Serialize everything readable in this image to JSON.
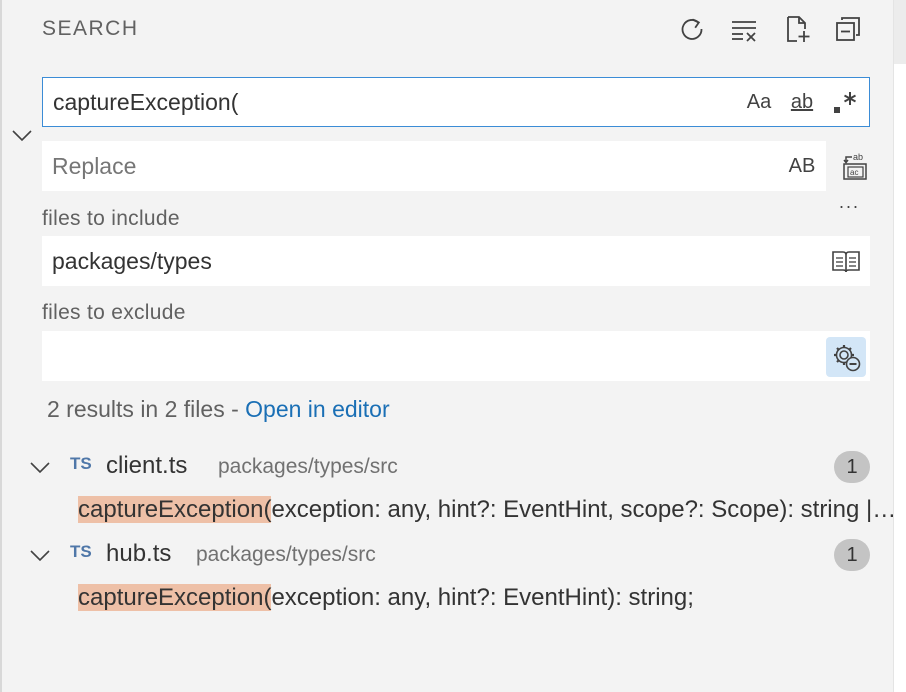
{
  "header": {
    "title": "SEARCH"
  },
  "search": {
    "value": "captureException(",
    "options": {
      "match_case": "Aa",
      "whole_word": "ab",
      "regex": ".*"
    }
  },
  "replace": {
    "placeholder": "Replace",
    "options": {
      "preserve_case": "AB"
    }
  },
  "more_label": "···",
  "include": {
    "label": "files to include",
    "value": "packages/types"
  },
  "exclude": {
    "label": "files to exclude",
    "value": ""
  },
  "summary": {
    "text": "2 results in 2 files - ",
    "link": "Open in editor"
  },
  "results": [
    {
      "lang": "TS",
      "file": "client.ts",
      "path": "packages/types/src",
      "count": "1",
      "match": "captureException(",
      "rest": "exception: any, hint?: EventHint, scope?: Scope): string | undefined;"
    },
    {
      "lang": "TS",
      "file": "hub.ts",
      "path": "packages/types/src",
      "count": "1",
      "match": "captureException(",
      "rest": "exception: any, hint?: EventHint): string;"
    }
  ],
  "colors": {
    "accent": "#3b8cd6",
    "link": "#1a6fb5",
    "highlight": "#eec0a7",
    "badge": "#c4c4c4",
    "ts_icon": "#4f77a8"
  }
}
